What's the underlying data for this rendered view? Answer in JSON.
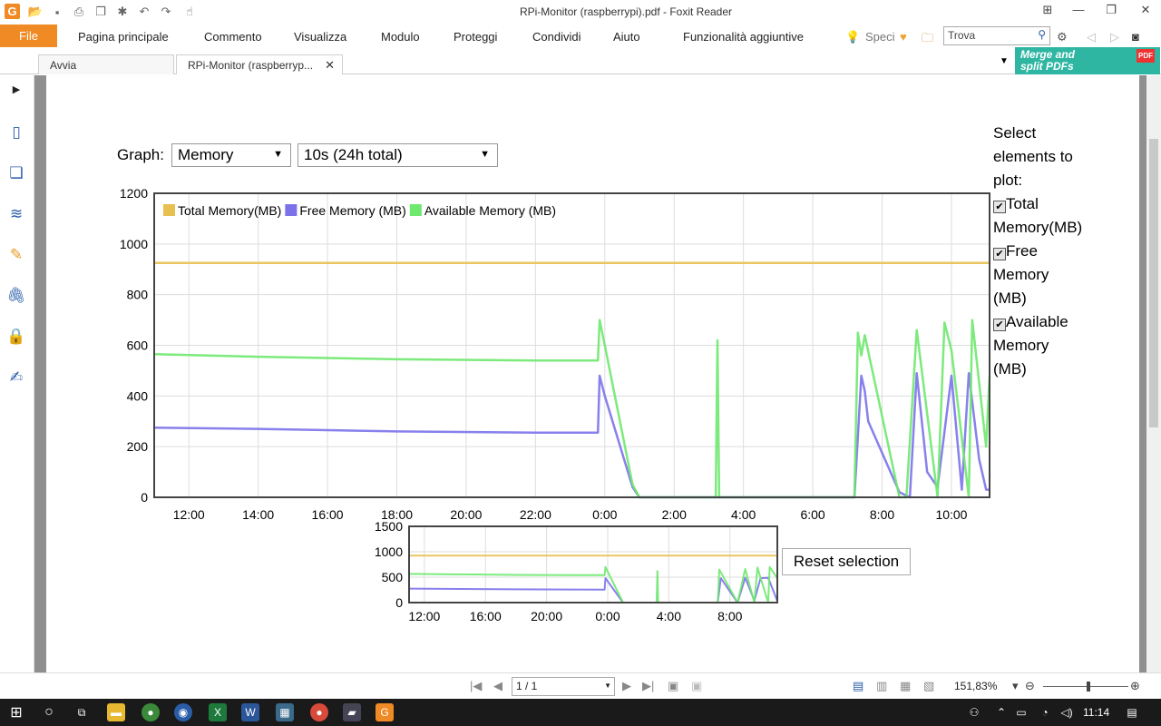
{
  "window": {
    "title": "RPi-Monitor (raspberrypi).pdf - Foxit Reader"
  },
  "menu": {
    "file": "File",
    "items": [
      "Pagina principale",
      "Commento",
      "Visualizza",
      "Modulo",
      "Proteggi",
      "Condividi",
      "Aiuto",
      "Funzionalità aggiuntive"
    ],
    "tell_me": "Speci",
    "find_placeholder": "Trova"
  },
  "tabs": [
    {
      "label": "Avvia"
    },
    {
      "label": "RPi-Monitor (raspberryp..."
    }
  ],
  "promo": {
    "line1": "Merge and",
    "line2": "split PDFs",
    "badge": "PDF"
  },
  "graph_controls": {
    "label": "Graph:",
    "graph_select": "Memory",
    "range_select": "10s (24h total)"
  },
  "plot_panel": {
    "heading_lines": [
      "Select",
      "elements to",
      "plot:"
    ],
    "options": [
      {
        "lines": [
          "Total",
          "Memory(MB)"
        ],
        "checked": true
      },
      {
        "lines": [
          "Free",
          "Memory",
          "(MB)"
        ],
        "checked": true
      },
      {
        "lines": [
          "Available",
          "Memory",
          "(MB)"
        ],
        "checked": true
      }
    ]
  },
  "reset_button": "Reset selection",
  "chart_data": [
    {
      "type": "line",
      "title": "",
      "xlabel": "",
      "ylabel": "",
      "ylim": [
        0,
        1200
      ],
      "yticks": [
        0,
        200,
        400,
        600,
        800,
        1000,
        1200
      ],
      "xticks": [
        "12:00",
        "14:00",
        "16:00",
        "18:00",
        "20:00",
        "22:00",
        "0:00",
        "2:00",
        "4:00",
        "6:00",
        "8:00",
        "10:00"
      ],
      "x_hours_range": [
        11.0,
        35.1
      ],
      "grid": true,
      "legend_position": "top-left",
      "series": [
        {
          "name": "Total Memory(MB)",
          "color": "#e8c050",
          "x": [
            11.0,
            35.1
          ],
          "values": [
            925,
            925
          ]
        },
        {
          "name": "Free Memory (MB)",
          "color": "#7b72ea",
          "x": [
            11.0,
            14.0,
            18.0,
            22.0,
            23.8,
            23.85,
            24.0,
            24.8,
            25.0,
            26.2,
            31.2,
            31.4,
            31.5,
            31.6,
            32.5,
            32.8,
            33.0,
            33.3,
            33.6,
            34.0,
            34.3,
            34.5,
            34.8,
            35.0,
            35.1
          ],
          "values": [
            275,
            270,
            260,
            255,
            255,
            480,
            400,
            40,
            0,
            0,
            0,
            480,
            420,
            300,
            20,
            0,
            490,
            100,
            40,
            480,
            30,
            490,
            150,
            30,
            30
          ]
        },
        {
          "name": "Available Memory (MB)",
          "color": "#6ee86e",
          "x": [
            11.0,
            14.0,
            18.0,
            22.0,
            23.8,
            23.85,
            24.0,
            24.8,
            25.0,
            27.2,
            27.25,
            27.3,
            31.2,
            31.3,
            31.4,
            31.5,
            32.5,
            32.7,
            33.0,
            33.6,
            33.8,
            34.0,
            34.5,
            34.6,
            35.0,
            35.1
          ],
          "values": [
            565,
            555,
            545,
            540,
            540,
            700,
            600,
            50,
            0,
            0,
            620,
            0,
            0,
            650,
            560,
            640,
            0,
            0,
            660,
            0,
            690,
            580,
            0,
            700,
            200,
            480
          ]
        }
      ]
    },
    {
      "type": "line",
      "title": "",
      "ylim": [
        0,
        1500
      ],
      "yticks": [
        0,
        500,
        1000,
        1500
      ],
      "xticks": [
        "12:00",
        "16:00",
        "20:00",
        "0:00",
        "4:00",
        "8:00"
      ],
      "x_hours_range": [
        11.0,
        35.1
      ],
      "grid": true,
      "series": [
        {
          "name": "Total Memory(MB)",
          "color": "#e8c050",
          "x": [
            11.0,
            35.1
          ],
          "values": [
            925,
            925
          ]
        },
        {
          "name": "Free Memory (MB)",
          "color": "#7b72ea",
          "x": [
            11.0,
            18.0,
            23.8,
            23.85,
            25.0,
            31.2,
            31.4,
            32.5,
            33.0,
            33.6,
            34.0,
            34.5,
            35.1
          ],
          "values": [
            275,
            260,
            255,
            480,
            0,
            0,
            480,
            0,
            490,
            40,
            480,
            490,
            30
          ]
        },
        {
          "name": "Available Memory (MB)",
          "color": "#6ee86e",
          "x": [
            11.0,
            18.0,
            23.8,
            23.85,
            25.0,
            27.2,
            27.25,
            27.3,
            31.2,
            31.3,
            32.5,
            33.0,
            33.6,
            33.8,
            34.5,
            34.6,
            35.1
          ],
          "values": [
            565,
            545,
            540,
            700,
            0,
            0,
            620,
            0,
            0,
            650,
            0,
            660,
            0,
            690,
            0,
            700,
            480
          ]
        }
      ]
    }
  ],
  "statusbar": {
    "page_value": "1 / 1",
    "zoom": "151,83%"
  },
  "taskbar": {
    "time": "11:14"
  }
}
